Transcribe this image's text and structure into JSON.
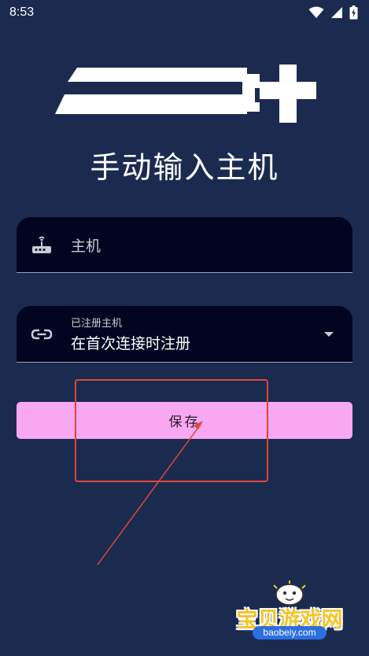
{
  "status_bar": {
    "time": "8:53",
    "icons": [
      "wifi-icon",
      "signal-icon",
      "battery-charging-icon"
    ]
  },
  "header": {
    "logo": "moonlight-logo",
    "title": "手动输入主机"
  },
  "form": {
    "host_field": {
      "icon": "router-icon",
      "placeholder": "主机"
    },
    "register_field": {
      "icon": "link-icon",
      "label": "已注册主机",
      "value": "在首次连接时注册",
      "arrow_icon": "dropdown-arrow-icon"
    },
    "save_label": "保存"
  },
  "watermark": {
    "brand": "宝贝游戏网",
    "url": "baobeiy.com"
  },
  "colors": {
    "background": "#1b2b4f",
    "field_background": "#020522",
    "save_button": "#f7a8f1",
    "annotation": "#e0463b",
    "watermark_text": "#f4c52a"
  }
}
